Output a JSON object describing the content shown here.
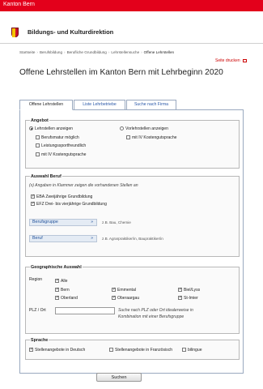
{
  "header": {
    "brand": "Kanton Bern",
    "org_name": "Bildungs- und Kulturdirektion"
  },
  "breadcrumb": [
    "Startseite",
    "Berufsbildung",
    "Berufliche Grundbildung",
    "Lehrstellensuche",
    "Offene Lehrstellen"
  ],
  "print_label": "Seite drucken",
  "title": "Offene Lehrstellen im Kanton Bern mit Lehrbeginn 2020",
  "tabs": [
    {
      "label": "Offene Lehrstellen",
      "active": true
    },
    {
      "label": "Liste Lehrbetriebe",
      "active": false
    },
    {
      "label": "Suche nach Firma",
      "active": false
    }
  ],
  "angebot": {
    "legend": "Angebot",
    "radio1": {
      "label": "Lehrstellen anzeigen",
      "checked": true
    },
    "radio2": {
      "label": "Vorlehrstellen anzeigen",
      "checked": false
    },
    "checks_left": [
      {
        "label": "Berufsmatur möglich",
        "checked": false
      },
      {
        "label": "Leistungssportfreundlich",
        "checked": false
      },
      {
        "label": "mit IV Kostengutsprache",
        "checked": false
      }
    ],
    "checks_right": [
      {
        "label": "mit IV Kostengutsprache",
        "checked": false
      }
    ]
  },
  "auswahl": {
    "legend": "Auswahl Beruf",
    "note": "(x) Angaben in Klammer zeigen die vorhandenen Stellen an",
    "eba": {
      "label": "EBA Zweijährige Grundbildung",
      "checked": true
    },
    "efz": {
      "label": "EFZ Drei- bis vierjährige Grundbildung",
      "checked": true
    },
    "berufsgruppe": {
      "label": "Berufsgruppe",
      "arrows": "»",
      "hint": "z.B. Bau, Chemie"
    },
    "beruf": {
      "label": "Beruf",
      "arrows": "»",
      "hint": "z.B. Agrarpraktiker/in, Baupraktiker/in"
    }
  },
  "geo": {
    "legend": "Geographische Auswahl",
    "region_label": "Region",
    "all": {
      "label": "Alle",
      "checked": true
    },
    "regions": [
      {
        "label": "Bern",
        "checked": true
      },
      {
        "label": "Emmental",
        "checked": true
      },
      {
        "label": "Biel/Lyss",
        "checked": true
      },
      {
        "label": "Oberland",
        "checked": true
      },
      {
        "label": "Oberaargau",
        "checked": true
      },
      {
        "label": "St-Imier",
        "checked": true
      }
    ],
    "plz_label": "PLZ / Ort",
    "plz_value": "",
    "plz_hint1": "Suche nach PLZ oder Ort idealerweise in",
    "plz_hint2": "Kombination mit einer Berufsgruppe"
  },
  "sprache": {
    "legend": "Sprache",
    "options": [
      {
        "label": "Stellenangebote in Deutsch",
        "checked": true
      },
      {
        "label": "Stellenangebote in Französisch",
        "checked": false
      },
      {
        "label": "bilingue",
        "checked": false
      }
    ]
  },
  "search_label": "Suchen",
  "colors": {
    "brand_red": "#e3001b",
    "link_blue": "#2a58a8"
  }
}
